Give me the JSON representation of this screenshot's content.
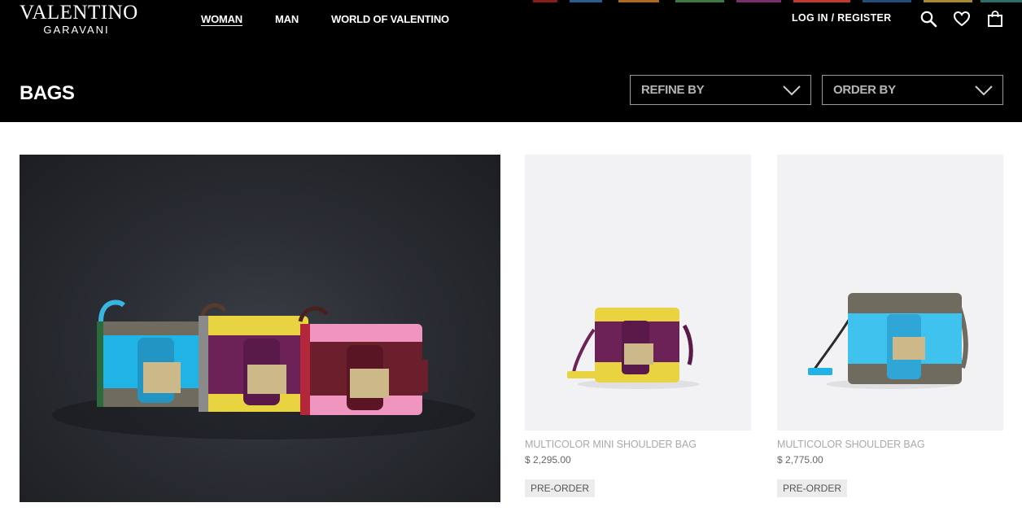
{
  "brand": {
    "line1": "VALENTINO",
    "line2": "GARAVANI"
  },
  "nav": [
    {
      "label": "WOMAN",
      "active": true
    },
    {
      "label": "MAN",
      "active": false
    },
    {
      "label": "WORLD OF VALENTINO",
      "active": false
    }
  ],
  "account": {
    "label": "LOG IN / REGISTER"
  },
  "icons": [
    "search-icon",
    "heart-icon",
    "shopping-bag-icon"
  ],
  "page": {
    "title": "BAGS"
  },
  "filters": {
    "refine_label": "REFINE BY",
    "order_label": "ORDER BY"
  },
  "products": [
    {
      "name": "MULTICOLOR MINI SHOULDER BAG",
      "price": "$ 2,295.00",
      "badge": "PRE-ORDER"
    },
    {
      "name": "MULTICOLOR SHOULDER BAG",
      "price": "$ 2,775.00",
      "badge": "PRE-ORDER"
    }
  ],
  "colors": {
    "header_bg": "#000000",
    "thumb_bg": "#f2f2f4",
    "muted_text": "#a9a9a9"
  }
}
